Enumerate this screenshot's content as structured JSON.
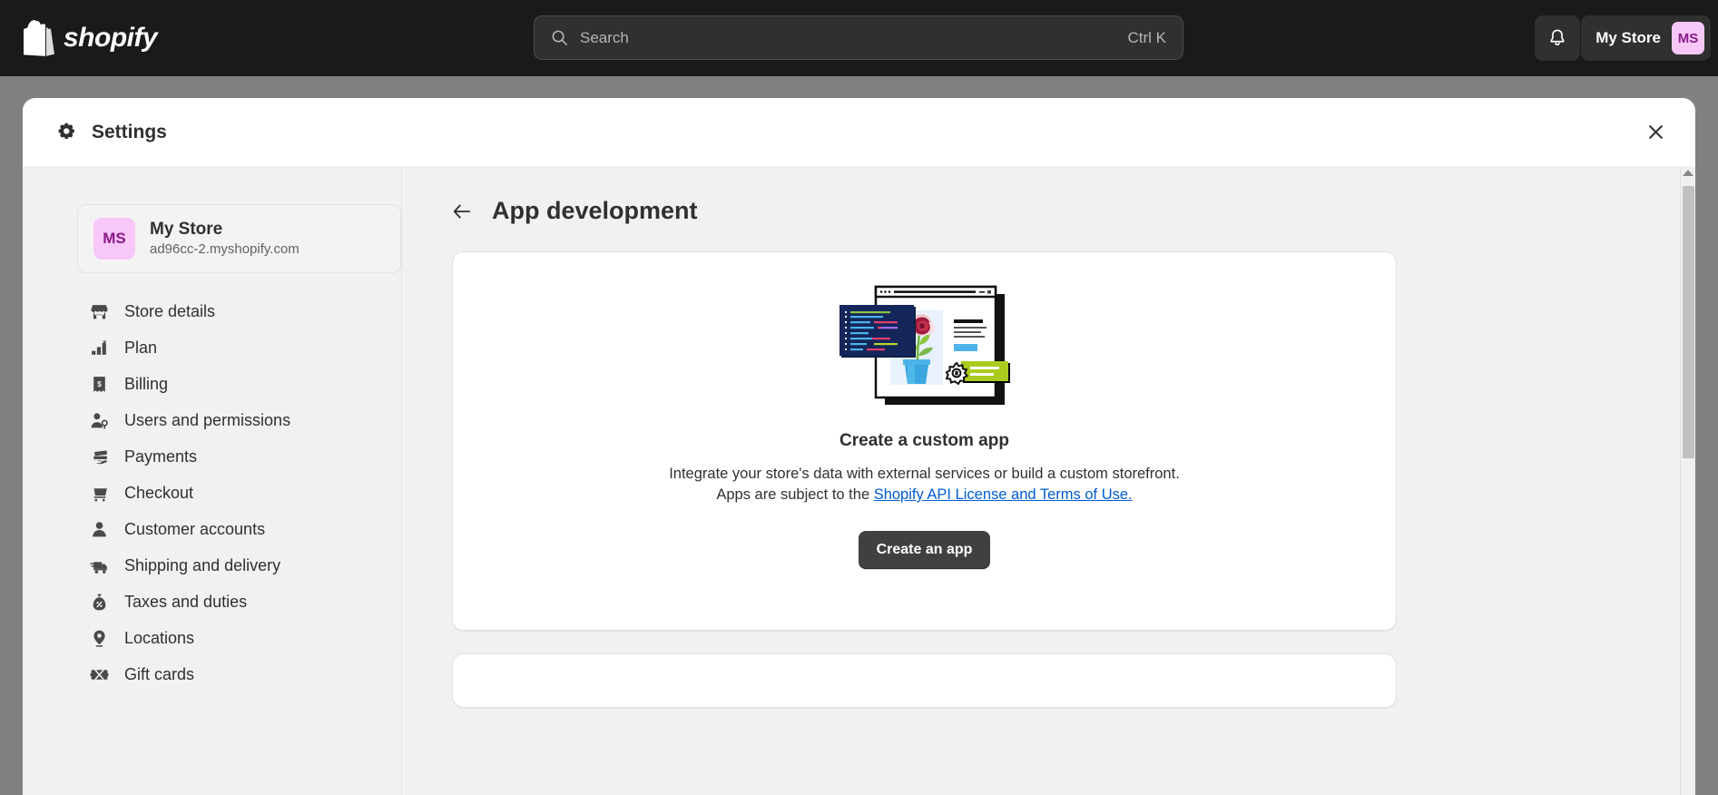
{
  "topbar": {
    "brand": "shopify",
    "brand_icon": "shopify-bag-logo",
    "search": {
      "placeholder": "Search",
      "shortcut": "Ctrl K",
      "icon": "search-icon"
    },
    "notifications_icon": "bell-icon",
    "store_name": "My Store",
    "store_initials": "MS"
  },
  "modal": {
    "title": "Settings",
    "title_icon": "gear-icon",
    "close_icon": "close-icon"
  },
  "sidebar": {
    "store": {
      "initials": "MS",
      "name": "My Store",
      "domain": "ad96cc-2.myshopify.com"
    },
    "items": [
      {
        "label": "Store details",
        "icon": "store-icon"
      },
      {
        "label": "Plan",
        "icon": "chart-bar-icon"
      },
      {
        "label": "Billing",
        "icon": "receipt-dollar-icon"
      },
      {
        "label": "Users and permissions",
        "icon": "person-key-icon"
      },
      {
        "label": "Payments",
        "icon": "payment-card-hand-icon"
      },
      {
        "label": "Checkout",
        "icon": "shopping-cart-icon"
      },
      {
        "label": "Customer accounts",
        "icon": "person-icon"
      },
      {
        "label": "Shipping and delivery",
        "icon": "delivery-truck-icon"
      },
      {
        "label": "Taxes and duties",
        "icon": "money-bag-percent-icon"
      },
      {
        "label": "Locations",
        "icon": "location-pin-icon"
      },
      {
        "label": "Gift cards",
        "icon": "gift-card-icon"
      }
    ]
  },
  "main": {
    "back_icon": "arrow-left-icon",
    "page_title": "App development",
    "empty_state": {
      "illustration": "custom-app-development-illustration",
      "title": "Create a custom app",
      "description_before": "Integrate your store's data with external services or build a custom storefront. Apps are subject to the ",
      "link_text": "Shopify API License and Terms of Use.",
      "button_label": "Create an app"
    }
  },
  "colors": {
    "topbar_bg": "#1a1a1a",
    "scrim": "#808080",
    "modal_bg": "#ffffff",
    "panel_bg": "#f1f1f1",
    "avatar_bg": "#f7c8f7",
    "avatar_fg": "#8a1a8a",
    "link": "#005bd3",
    "button_bg": "#404040",
    "text": "#303030"
  }
}
